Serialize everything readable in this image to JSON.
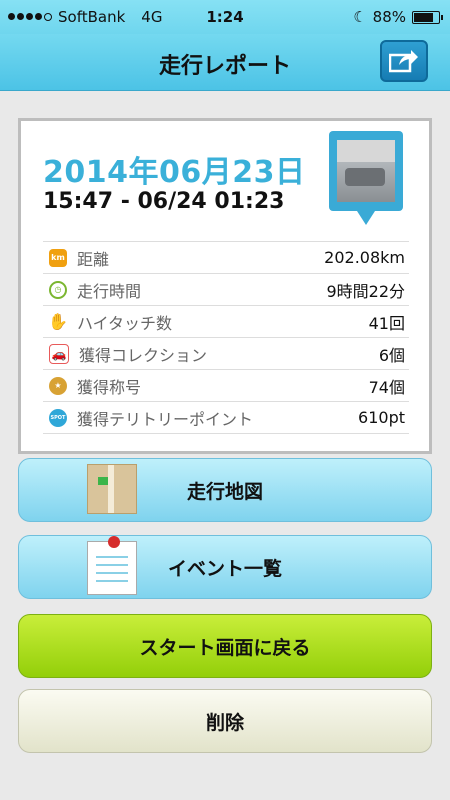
{
  "status_bar": {
    "carrier": "SoftBank",
    "network": "4G",
    "time": "1:24",
    "battery": "88%",
    "battery_level": 0.88
  },
  "nav": {
    "title": "走行レポート",
    "share_icon": "share-arrow-icon"
  },
  "report": {
    "date": "2014年06月23日",
    "time_range": "15:47 - 06/24 01:23",
    "photo_icon": "location-photo-pin-icon"
  },
  "stats": [
    {
      "icon": "km-icon",
      "icon_text": "km",
      "label": "距離",
      "value": "202.08km",
      "color": "#f0a010"
    },
    {
      "icon": "clock-icon",
      "icon_text": "",
      "label": "走行時間",
      "value": "9時間22分",
      "color": "#7bb630"
    },
    {
      "icon": "hand-icon",
      "icon_text": "",
      "label": "ハイタッチ数",
      "value": "41回",
      "color": "#4ab3e6"
    },
    {
      "icon": "car-icon",
      "icon_text": "",
      "label": "獲得コレクション",
      "value": "6個",
      "color": "#e85a5a"
    },
    {
      "icon": "medal-icon",
      "icon_text": "",
      "label": "獲得称号",
      "value": "74個",
      "color": "#d8a234"
    },
    {
      "icon": "spot-icon",
      "icon_text": "SPOT",
      "label": "獲得テリトリーポイント",
      "value": "610pt",
      "color": "#2fa7d8"
    }
  ],
  "buttons": {
    "map": "走行地図",
    "events": "イベント一覧",
    "back_to_start": "スタート画面に戻る",
    "delete": "削除"
  }
}
